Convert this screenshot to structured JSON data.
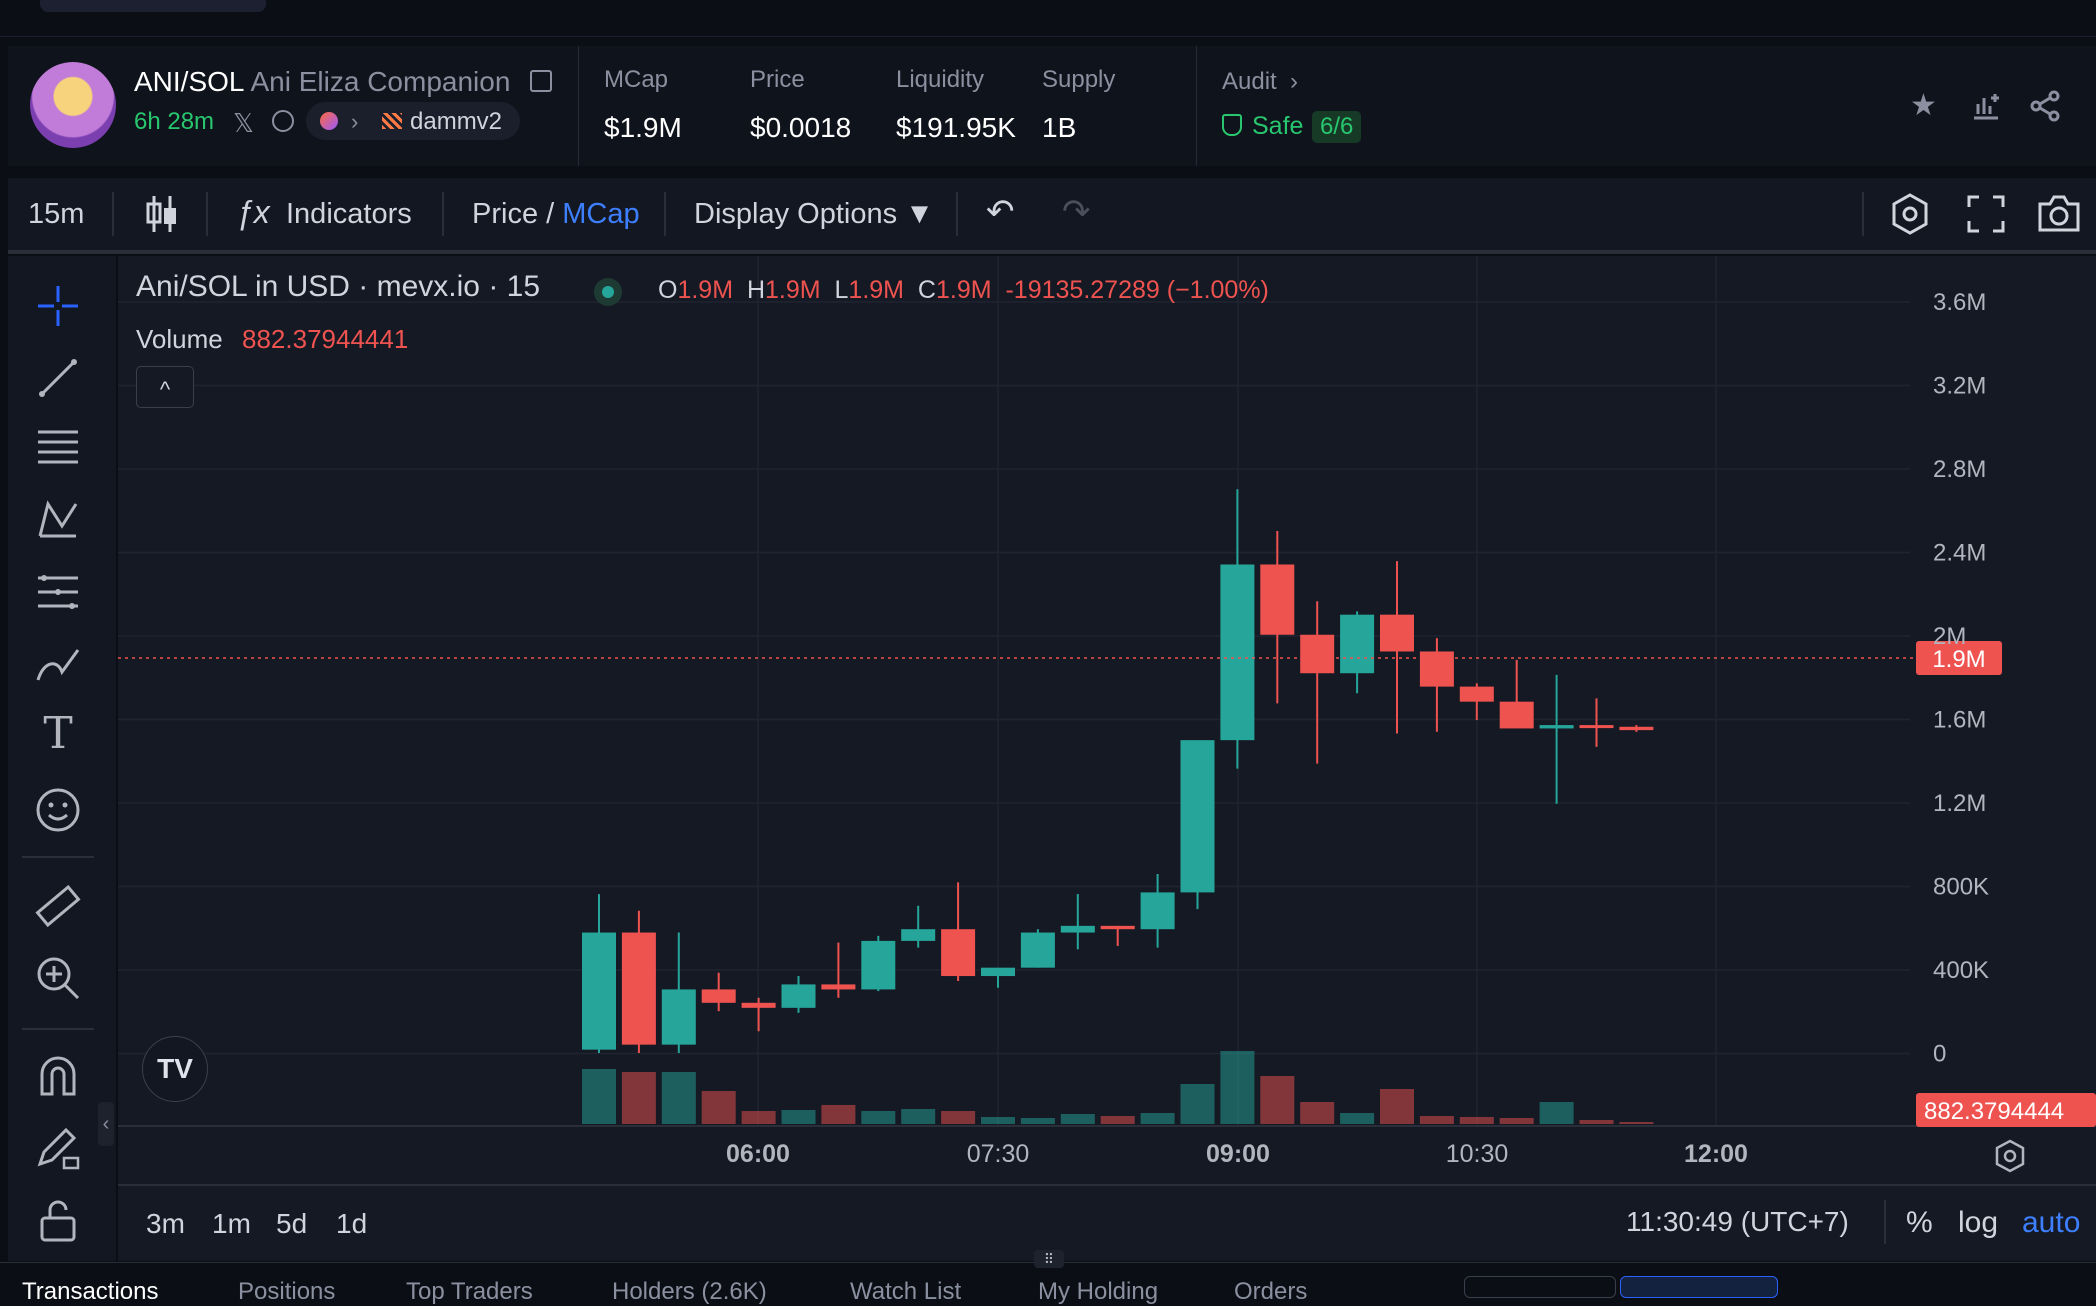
{
  "header": {
    "pair": "ANI/SOL",
    "token_name": "Ani Eliza Companion",
    "age": "6h 28m",
    "x_glyph": "𝕏",
    "dex_label": "dammv2",
    "stats": [
      {
        "label": "MCap",
        "value": "$1.9M"
      },
      {
        "label": "Price",
        "value": "$0.0018"
      },
      {
        "label": "Liquidity",
        "value": "$191.95K"
      },
      {
        "label": "Supply",
        "value": "1B"
      }
    ],
    "audit_label": "Audit",
    "audit_chevron": "›",
    "safe_label": "Safe",
    "safe_ratio": "6/6",
    "safe_color": "#28c76f"
  },
  "toolbar": {
    "interval": "15m",
    "indicators_label": "Indicators",
    "price_label": "Price",
    "slash": " / ",
    "mcap_label": "MCap",
    "display_options_label": "Display Options ▼",
    "undo_glyph": "↶",
    "redo_glyph": "↷"
  },
  "legend": {
    "title": "Ani/SOL in USD · mevx.io · 15",
    "o_key": "O",
    "o_val": "1.9M",
    "h_key": "H",
    "h_val": "1.9M",
    "l_key": "L",
    "l_val": "1.9M",
    "c_key": "C",
    "c_val": "1.9M",
    "change": "-19135.27289 (−1.00%)",
    "volume_label": "Volume",
    "volume_value": "882.37944441",
    "collapse_glyph": "^"
  },
  "chart_data": {
    "type": "candlestick",
    "y_ticks": [
      "3.6M",
      "3.2M",
      "2.8M",
      "2.4M",
      "2M",
      "1.6M",
      "1.2M",
      "800K",
      "400K",
      "0"
    ],
    "x_ticks": [
      "06:00",
      "07:30",
      "09:00",
      "10:30",
      "12:00"
    ],
    "x_bold": [
      true,
      false,
      true,
      false,
      true
    ],
    "last_price_label": "1.9M",
    "last_volume_label": "882.3794444",
    "up_color": "#26a69a",
    "down_color": "#ef5350",
    "candles": [
      {
        "o": 0.02,
        "h": 0.95,
        "l": 0.0,
        "c": 0.72,
        "v": 55
      },
      {
        "o": 0.72,
        "h": 0.85,
        "l": 0.0,
        "c": 0.05,
        "v": 52
      },
      {
        "o": 0.05,
        "h": 0.72,
        "l": 0.0,
        "c": 0.38,
        "v": 52
      },
      {
        "o": 0.38,
        "h": 0.48,
        "l": 0.25,
        "c": 0.3,
        "v": 33
      },
      {
        "o": 0.3,
        "h": 0.33,
        "l": 0.13,
        "c": 0.27,
        "v": 13
      },
      {
        "o": 0.27,
        "h": 0.46,
        "l": 0.24,
        "c": 0.41,
        "v": 14
      },
      {
        "o": 0.41,
        "h": 0.66,
        "l": 0.33,
        "c": 0.38,
        "v": 19
      },
      {
        "o": 0.38,
        "h": 0.7,
        "l": 0.37,
        "c": 0.67,
        "v": 13
      },
      {
        "o": 0.67,
        "h": 0.88,
        "l": 0.63,
        "c": 0.74,
        "v": 15
      },
      {
        "o": 0.74,
        "h": 1.02,
        "l": 0.43,
        "c": 0.46,
        "v": 13
      },
      {
        "o": 0.46,
        "h": 0.48,
        "l": 0.39,
        "c": 0.51,
        "v": 7
      },
      {
        "o": 0.51,
        "h": 0.74,
        "l": 0.51,
        "c": 0.72,
        "v": 6
      },
      {
        "o": 0.72,
        "h": 0.95,
        "l": 0.62,
        "c": 0.76,
        "v": 10
      },
      {
        "o": 0.76,
        "h": 0.76,
        "l": 0.64,
        "c": 0.74,
        "v": 8
      },
      {
        "o": 0.74,
        "h": 1.07,
        "l": 0.63,
        "c": 0.96,
        "v": 11
      },
      {
        "o": 0.96,
        "h": 1.61,
        "l": 0.86,
        "c": 1.87,
        "v": 40
      },
      {
        "o": 1.87,
        "h": 3.37,
        "l": 1.7,
        "c": 2.92,
        "v": 73
      },
      {
        "o": 2.92,
        "h": 3.12,
        "l": 2.09,
        "c": 2.5,
        "v": 48
      },
      {
        "o": 2.5,
        "h": 2.7,
        "l": 1.73,
        "c": 2.27,
        "v": 22
      },
      {
        "o": 2.27,
        "h": 2.64,
        "l": 2.15,
        "c": 2.62,
        "v": 11
      },
      {
        "o": 2.62,
        "h": 2.94,
        "l": 1.91,
        "c": 2.4,
        "v": 35
      },
      {
        "o": 2.4,
        "h": 2.48,
        "l": 1.92,
        "c": 2.19,
        "v": 8
      },
      {
        "o": 2.19,
        "h": 2.21,
        "l": 1.99,
        "c": 2.1,
        "v": 7
      },
      {
        "o": 2.1,
        "h": 2.35,
        "l": 1.99,
        "c": 1.94,
        "v": 6
      },
      {
        "o": 1.94,
        "h": 2.26,
        "l": 1.49,
        "c": 1.96,
        "v": 22
      },
      {
        "o": 1.96,
        "h": 2.12,
        "l": 1.83,
        "c": 1.95,
        "v": 4
      },
      {
        "o": 1.95,
        "h": 1.96,
        "l": 1.92,
        "c": 1.93,
        "v": 2
      }
    ]
  },
  "bottom": {
    "ranges": [
      "3m",
      "1m",
      "5d",
      "1d"
    ],
    "time": "11:30:49 (UTC+7)",
    "percent": "%",
    "log": "log",
    "auto": "auto",
    "tabs": [
      "Transactions",
      "Positions",
      "Top Traders",
      "Holders (2.6K)",
      "Watch List",
      "My Holding",
      "Orders"
    ]
  }
}
